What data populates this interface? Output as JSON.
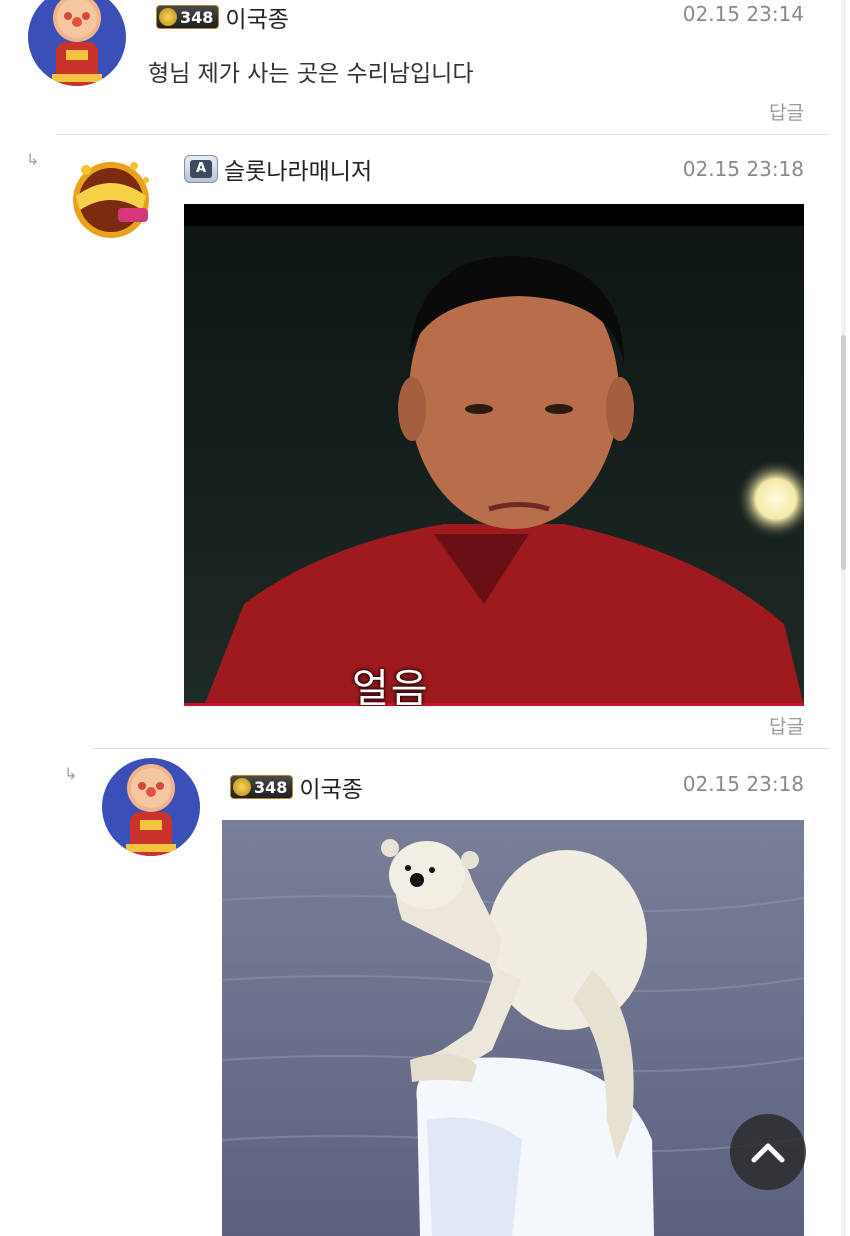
{
  "comments": [
    {
      "level": "348",
      "name": "이국종",
      "time": "02.15 23:14",
      "text": "형님 제가 사는 곳은 수리남입니다",
      "reply_label": "답글"
    },
    {
      "admin_badge": "A",
      "name": "슬롯나라매니저",
      "time": "02.15 23:18",
      "image_caption": "얼음",
      "reply_label": "답글"
    },
    {
      "level": "348",
      "name": "이국종",
      "time": "02.15 23:18"
    }
  ],
  "reply_arrow": "↳",
  "scroll_top_icon": "chevron-up-icon",
  "colors": {
    "time": "#8a8a8a",
    "reply": "#9a9a9a",
    "badge_gold": "#b08a2a",
    "scroll_button": "#282828"
  }
}
